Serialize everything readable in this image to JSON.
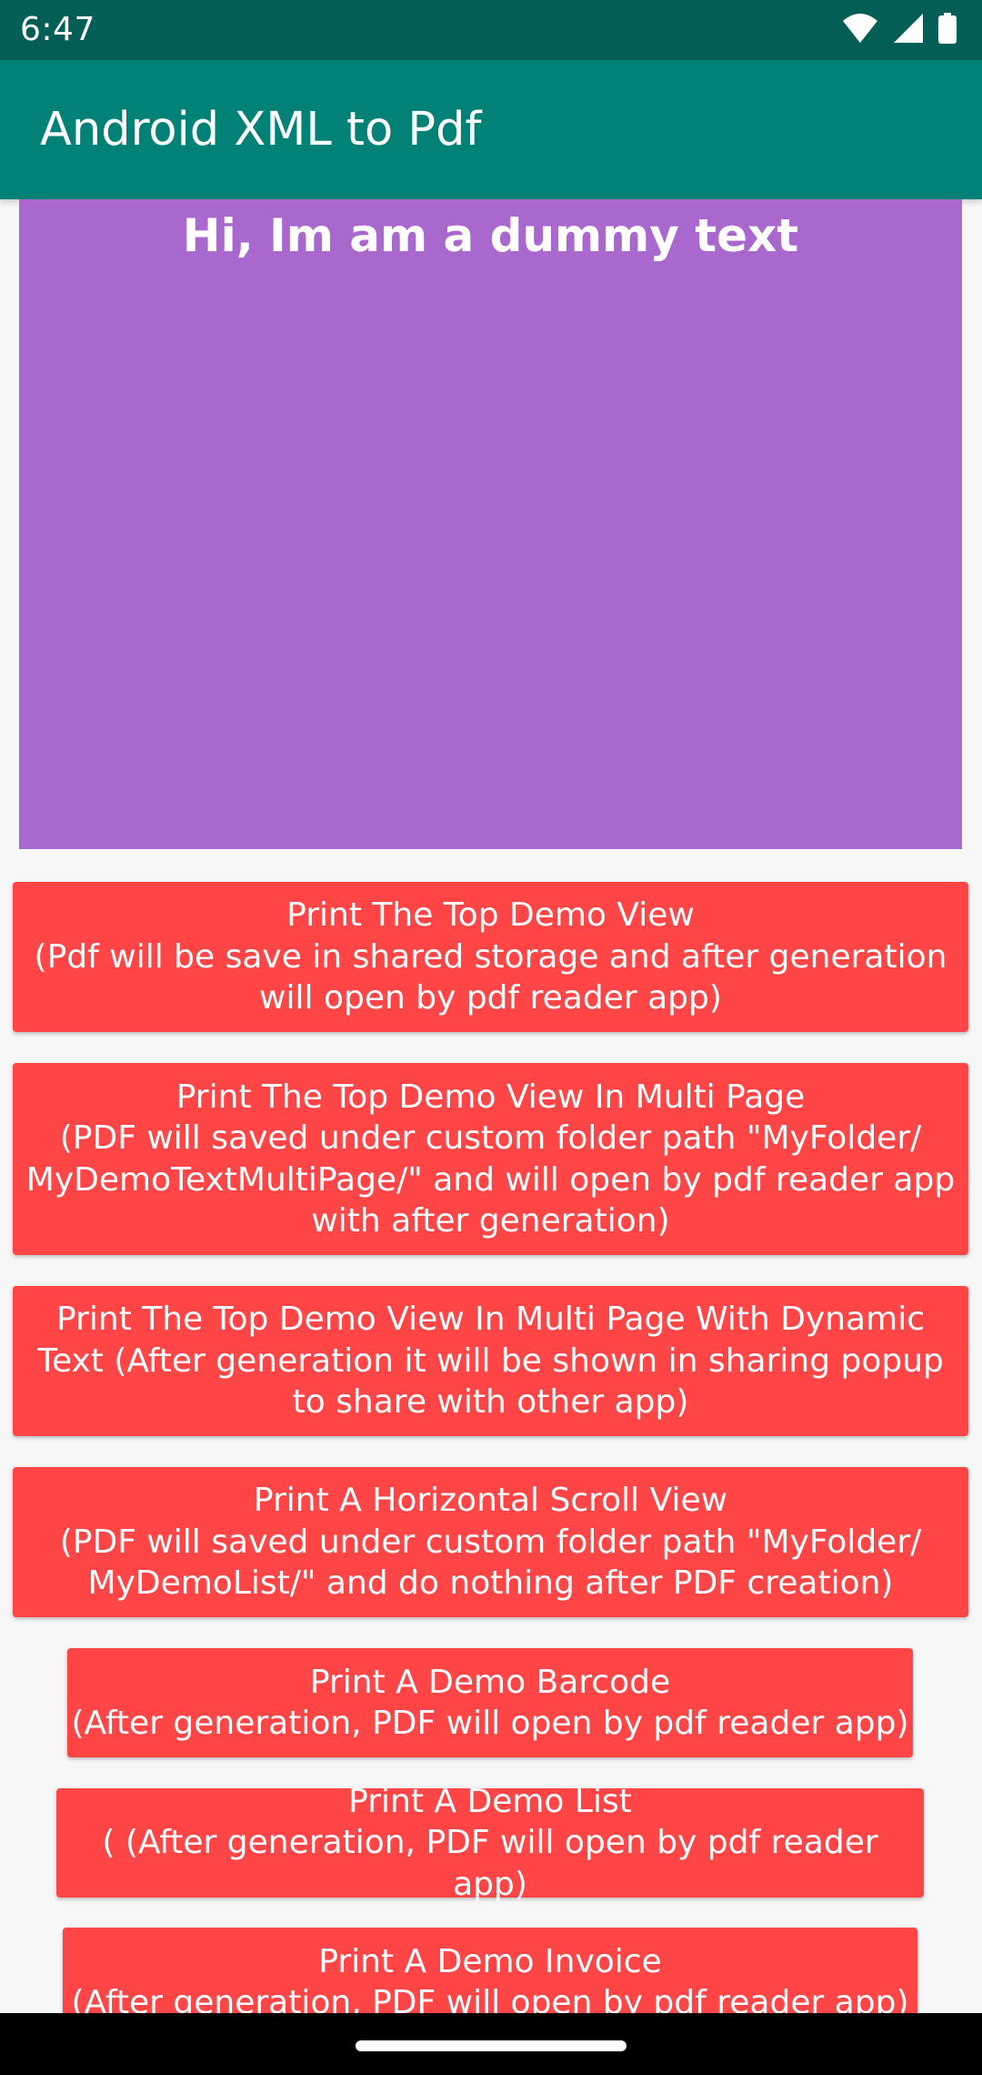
{
  "status_bar": {
    "time": "6:47"
  },
  "app_bar": {
    "title": "Android XML to Pdf"
  },
  "demo_view": {
    "text": "Hi, Im am a dummy text",
    "background": "#a968ce"
  },
  "buttons": [
    {
      "label": "Print The Top Demo View\n(Pdf will be save in shared storage and after generation\nwill open by pdf reader app)"
    },
    {
      "label": "Print The Top Demo View In Multi Page\n(PDF will saved under custom folder path \"MyFolder/\nMyDemoTextMultiPage/\" and will open by pdf reader app\nwith after generation)"
    },
    {
      "label": "Print The Top Demo View In Multi Page With Dynamic\nText (After generation it will be shown in sharing popup\nto share with other app)"
    },
    {
      "label": "Print A Horizontal Scroll View\n(PDF will saved under custom folder path \"MyFolder/\nMyDemoList/\" and do nothing after PDF creation)"
    },
    {
      "label": "Print A Demo Barcode\n(After generation, PDF will open by pdf reader app)"
    },
    {
      "label": "Print A Demo List\n( (After generation, PDF will open by pdf reader app)"
    },
    {
      "label": "Print A Demo Invoice\n(After generation, PDF will open by pdf reader app)"
    }
  ],
  "colors": {
    "status_bar": "#035f55",
    "app_bar": "#028176",
    "button": "#ff4545",
    "background": "#f7f7f7"
  },
  "icons": {
    "wifi": "wifi-icon",
    "signal": "cell-signal-icon",
    "battery": "battery-icon"
  }
}
